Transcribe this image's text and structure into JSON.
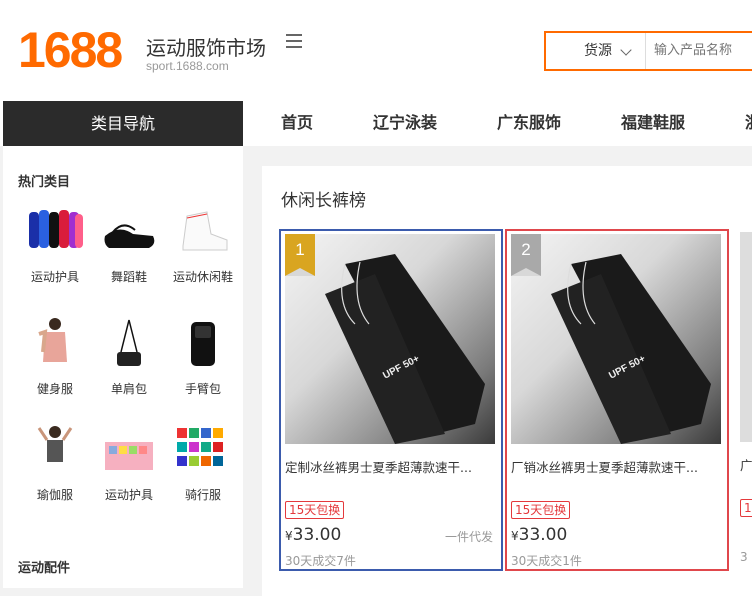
{
  "header": {
    "logo": "1688",
    "site_title": "运动服饰市场",
    "site_url": "sport.1688.com",
    "search_type": "货源",
    "search_placeholder": "输入产品名称"
  },
  "nav": {
    "category_nav": "类目导航",
    "items": [
      "首页",
      "辽宁泳装",
      "广东服饰",
      "福建鞋服",
      "浙"
    ]
  },
  "sidebar": {
    "hot_heading": "热门类目",
    "categories": [
      "运动护具",
      "舞蹈鞋",
      "运动休闲鞋",
      "健身服",
      "单肩包",
      "手臂包",
      "瑜伽服",
      "运动护具",
      "骑行服"
    ],
    "accessories_heading": "运动配件"
  },
  "ranking": {
    "title": "休闲长裤榜",
    "items": [
      {
        "rank": "1",
        "name": "定制冰丝裤男士夏季超薄款速干...",
        "tag": "15天包换",
        "currency": "¥",
        "price": "33.00",
        "dropship": "一件代发",
        "sold": "30天成交7件",
        "rank_color": "#d9a520",
        "border": "#3b5bad",
        "print": "UPF 50+"
      },
      {
        "rank": "2",
        "name": "厂销冰丝裤男士夏季超薄款速干...",
        "tag": "15天包换",
        "currency": "¥",
        "price": "33.00",
        "dropship": "",
        "sold": "30天成交1件",
        "rank_color": "#a9a9a9",
        "border": "#e0474c",
        "print": "UPF 50+"
      },
      {
        "rank": "",
        "name": "广",
        "tag": "1",
        "currency": "",
        "price": "",
        "dropship": "",
        "sold": "3",
        "rank_color": "",
        "border": "",
        "print": ""
      }
    ]
  }
}
